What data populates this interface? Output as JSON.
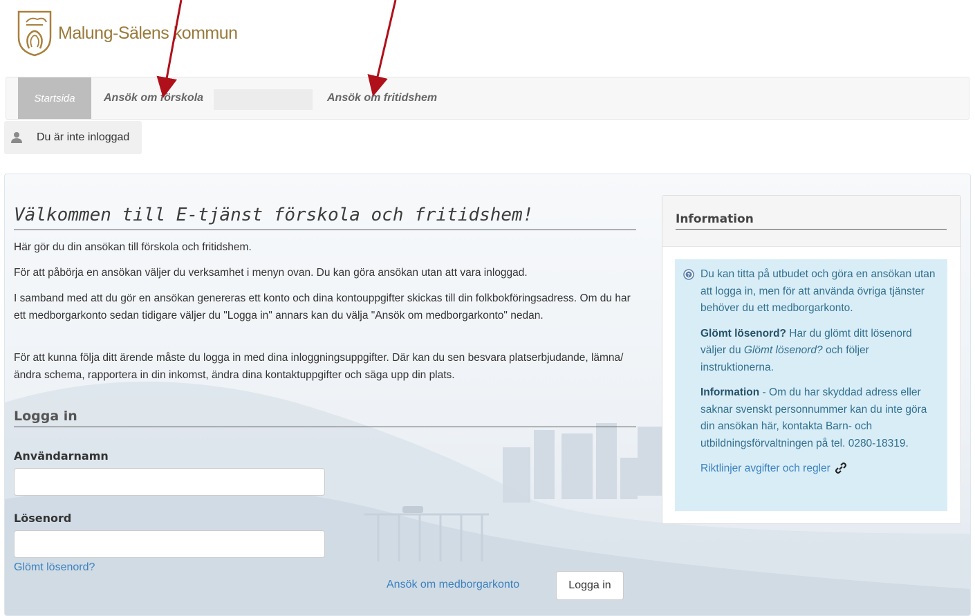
{
  "logo": {
    "name": "Malung-Sälens kommun"
  },
  "nav": {
    "home": "Startsida",
    "items": [
      "Ansök om förskola",
      "Ansök om fritidshem"
    ]
  },
  "status": {
    "text": "Du är inte inloggad"
  },
  "main": {
    "title": "Välkommen till E-tjänst förskola och fritidshem!",
    "paragraphs": [
      "Här gör du din ansökan till förskola och fritidshem.",
      "För att påbörja en ansökan väljer du verksamhet i menyn ovan. Du kan göra ansökan utan att vara inloggad.",
      "I samband med att du gör en ansökan genereras ett konto och dina kontouppgifter skickas till din folkbokföringsadress. Om du har ett medborgarkonto sedan tidigare väljer du \"Logga in\" annars kan du välja \"Ansök om medborgarkonto\" nedan.",
      "För att kunna följa ditt ärende måste du logga in med dina inloggningsuppgifter. Där kan du sen besvara platserbjudande, lämna/ändra schema, rapportera in din inkomst, ändra dina kontaktuppgifter och säga upp din plats."
    ]
  },
  "login": {
    "title": "Logga in",
    "username_label": "Användarnamn",
    "username_value": "",
    "password_label": "Lösenord",
    "password_value": "",
    "forgot": "Glömt lösenord?",
    "apply": "Ansök om medborgarkonto",
    "button": "Logga in"
  },
  "info": {
    "title": "Information",
    "intro": "Du kan titta på utbudet och göra en ansökan utan att logga in, men för att använda övriga tjänster behöver du ett medborgarkonto.",
    "forgot_bold": "Glömt lösenord?",
    "forgot_text_1": " Har du glömt ditt lösenord väljer du ",
    "forgot_italic": "Glömt lösenord?",
    "forgot_text_2": " och följer instruktionerna.",
    "info_bold": "Information",
    "info_text": " - Om du har skyddad adress eller saknar svenskt personnummer kan du inte göra din ansökan här, kontakta Barn- och utbildningsförvaltningen på tel. 0280-18319.",
    "link": "Riktlinjer avgifter och regler"
  },
  "colors": {
    "accent": "#3a81bf",
    "info_bg": "#d9edf7",
    "arrow": "#b0101a"
  }
}
